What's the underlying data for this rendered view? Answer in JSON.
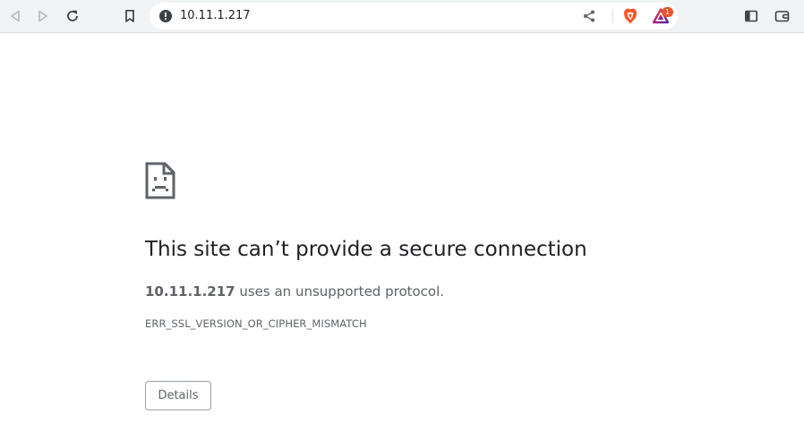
{
  "toolbar": {
    "back_icon": "back-arrow-icon",
    "forward_icon": "forward-arrow-icon",
    "reload_icon": "reload-icon",
    "bookmark_icon": "bookmark-icon",
    "sidebar_icon": "sidebar-icon",
    "wallet_icon": "wallet-icon"
  },
  "omnibox": {
    "security_icon": "not-secure-info-icon",
    "url": "10.11.1.217",
    "share_icon": "share-icon",
    "shields_icon": "brave-shields-icon",
    "rewards_icon": "brave-rewards-icon",
    "rewards_badge": "1"
  },
  "error_page": {
    "icon": "sad-document-icon",
    "title": "This site can’t provide a secure connection",
    "host": "10.11.1.217",
    "message": " uses an unsupported protocol.",
    "code": "ERR_SSL_VERSION_OR_CIPHER_MISMATCH",
    "details_label": "Details"
  },
  "colors": {
    "toolbar_bg": "#f1f3f4",
    "text_primary": "#202124",
    "text_secondary": "#5f6368",
    "brave_orange": "#fb542b",
    "badge": "#e8562a"
  }
}
